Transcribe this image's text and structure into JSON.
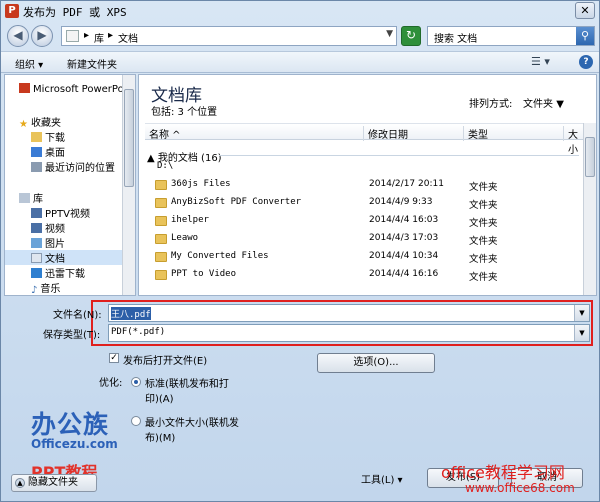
{
  "window": {
    "title": "发布为 PDF 或 XPS",
    "app_icon": "P",
    "close_glyph": "✕"
  },
  "address": {
    "crumbs": [
      "库",
      "文档"
    ],
    "search_placeholder": "搜索 文档"
  },
  "toolbar": {
    "organize": "组织",
    "new_folder": "新建文件夹"
  },
  "nav": {
    "items": [
      {
        "label": "Microsoft PowerPo",
        "icon": "powerpoint-icon"
      },
      {
        "label": "收藏夹",
        "icon": "star-icon"
      },
      {
        "label": "下载",
        "icon": "download-folder-icon"
      },
      {
        "label": "桌面",
        "icon": "desktop-icon"
      },
      {
        "label": "最近访问的位置",
        "icon": "recent-places-icon"
      },
      {
        "label": "库",
        "icon": "library-icon"
      },
      {
        "label": "PPTV视频",
        "icon": "video-library-icon"
      },
      {
        "label": "视频",
        "icon": "video-library-icon"
      },
      {
        "label": "图片",
        "icon": "pictures-library-icon"
      },
      {
        "label": "文档",
        "icon": "documents-library-icon"
      },
      {
        "label": "迅雷下载",
        "icon": "thunder-download-icon"
      },
      {
        "label": "音乐",
        "icon": "music-library-icon"
      }
    ]
  },
  "main": {
    "library_title": "文档库",
    "library_sub": "包括: 3 个位置",
    "sort_label": "排列方式:",
    "sort_value": "文件夹",
    "columns": {
      "name": "名称",
      "date": "修改日期",
      "type": "类型",
      "size": "大小"
    },
    "group": {
      "title": "我的文档 (16)",
      "path": "D:\\"
    },
    "files": [
      {
        "name": "360js Files",
        "date": "2014/2/17 20:11",
        "type": "文件夹"
      },
      {
        "name": "AnyBizSoft PDF Converter",
        "date": "2014/4/9 9:33",
        "type": "文件夹"
      },
      {
        "name": "ihelper",
        "date": "2014/4/4 16:03",
        "type": "文件夹"
      },
      {
        "name": "Leawo",
        "date": "2014/4/3 17:03",
        "type": "文件夹"
      },
      {
        "name": "My Converted Files",
        "date": "2014/4/4 10:34",
        "type": "文件夹"
      },
      {
        "name": "PPT to Video",
        "date": "2014/4/4 16:16",
        "type": "文件夹"
      }
    ]
  },
  "form": {
    "filename_label": "文件名(N):",
    "filename_value": "王八.pdf",
    "savetype_label": "保存类型(T):",
    "savetype_value": "PDF(*.pdf)",
    "open_after_label": "发布后打开文件(E)",
    "options_button": "选项(O)...",
    "optimize_label": "优化:",
    "standard_line1": "标准(联机发布和打",
    "standard_line2": "印)(A)",
    "minimum_line1": "最小文件大小(联机发",
    "minimum_line2": "布)(M)",
    "tools_label": "工具(L)",
    "publish_button": "发布(S)",
    "cancel_button": "取消",
    "hide_folders": "隐藏文件夹"
  },
  "overlay": {
    "logo_main": "办公族",
    "logo_sub": "Officezu.com",
    "logo_ppt": "PPT教程",
    "watermark_1": "office教程学习网",
    "watermark_2": "www.office68.com"
  },
  "colors": {
    "highlight_box": "#e0201e",
    "accent": "#2c61b8"
  }
}
